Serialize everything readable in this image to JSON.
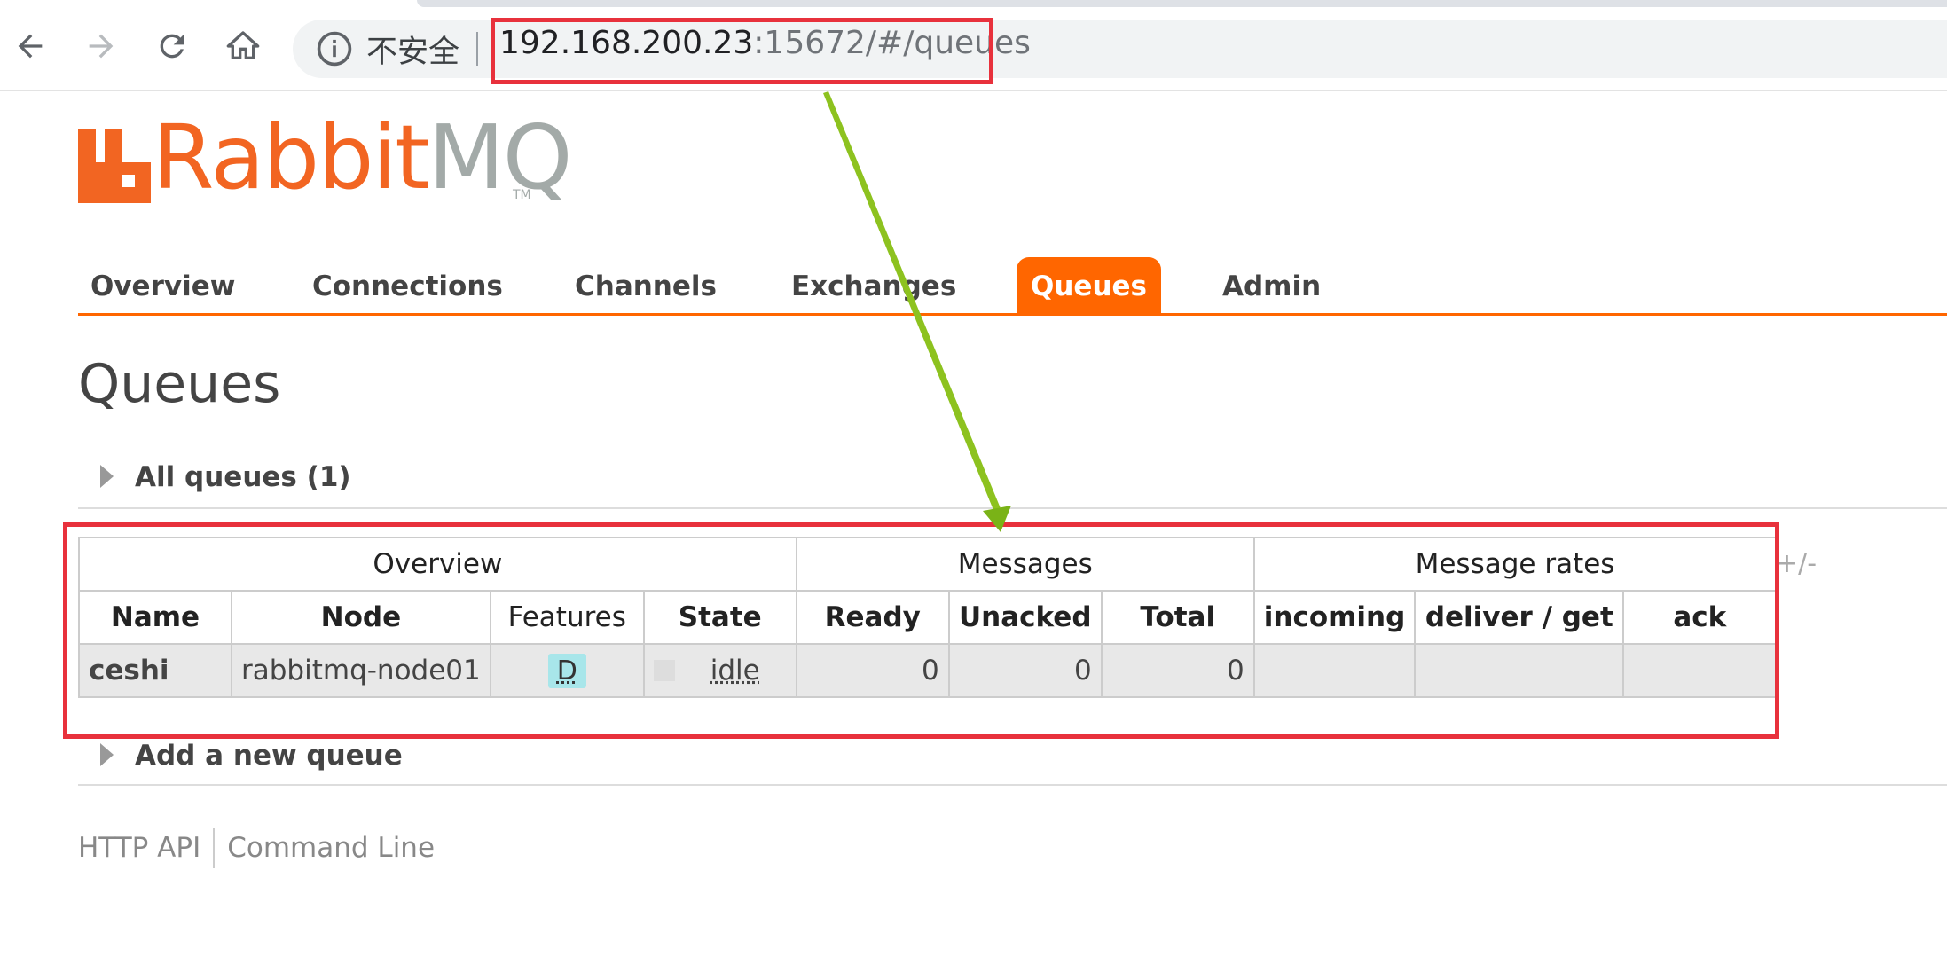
{
  "browser": {
    "security_label": "不安全",
    "url_host": "192.168.200.23",
    "url_rest": ":15672/#/queues"
  },
  "logo": {
    "part1": "Rabbit",
    "part2": "MQ",
    "tm": "TM"
  },
  "tabs": [
    {
      "label": "Overview",
      "active": false
    },
    {
      "label": "Connections",
      "active": false
    },
    {
      "label": "Channels",
      "active": false
    },
    {
      "label": "Exchanges",
      "active": false
    },
    {
      "label": "Queues",
      "active": true
    },
    {
      "label": "Admin",
      "active": false
    }
  ],
  "page": {
    "title": "Queues",
    "all_queues_label": "All queues (1)",
    "add_queue_label": "Add a new queue",
    "toggle_columns": "+/-"
  },
  "table": {
    "groups": [
      "Overview",
      "Messages",
      "Message rates"
    ],
    "columns": [
      "Name",
      "Node",
      "Features",
      "State",
      "Ready",
      "Unacked",
      "Total",
      "incoming",
      "deliver / get",
      "ack"
    ],
    "rows": [
      {
        "name": "ceshi",
        "node": "rabbitmq-node01",
        "feature": "D",
        "state": "idle",
        "ready": "0",
        "unacked": "0",
        "total": "0",
        "incoming": "",
        "deliver_get": "",
        "ack": ""
      }
    ]
  },
  "footer": {
    "http_api": "HTTP API",
    "command_line": "Command Line"
  },
  "colors": {
    "accent": "#ff6600",
    "highlight": "#e8313c",
    "arrow": "#8dc21f"
  }
}
